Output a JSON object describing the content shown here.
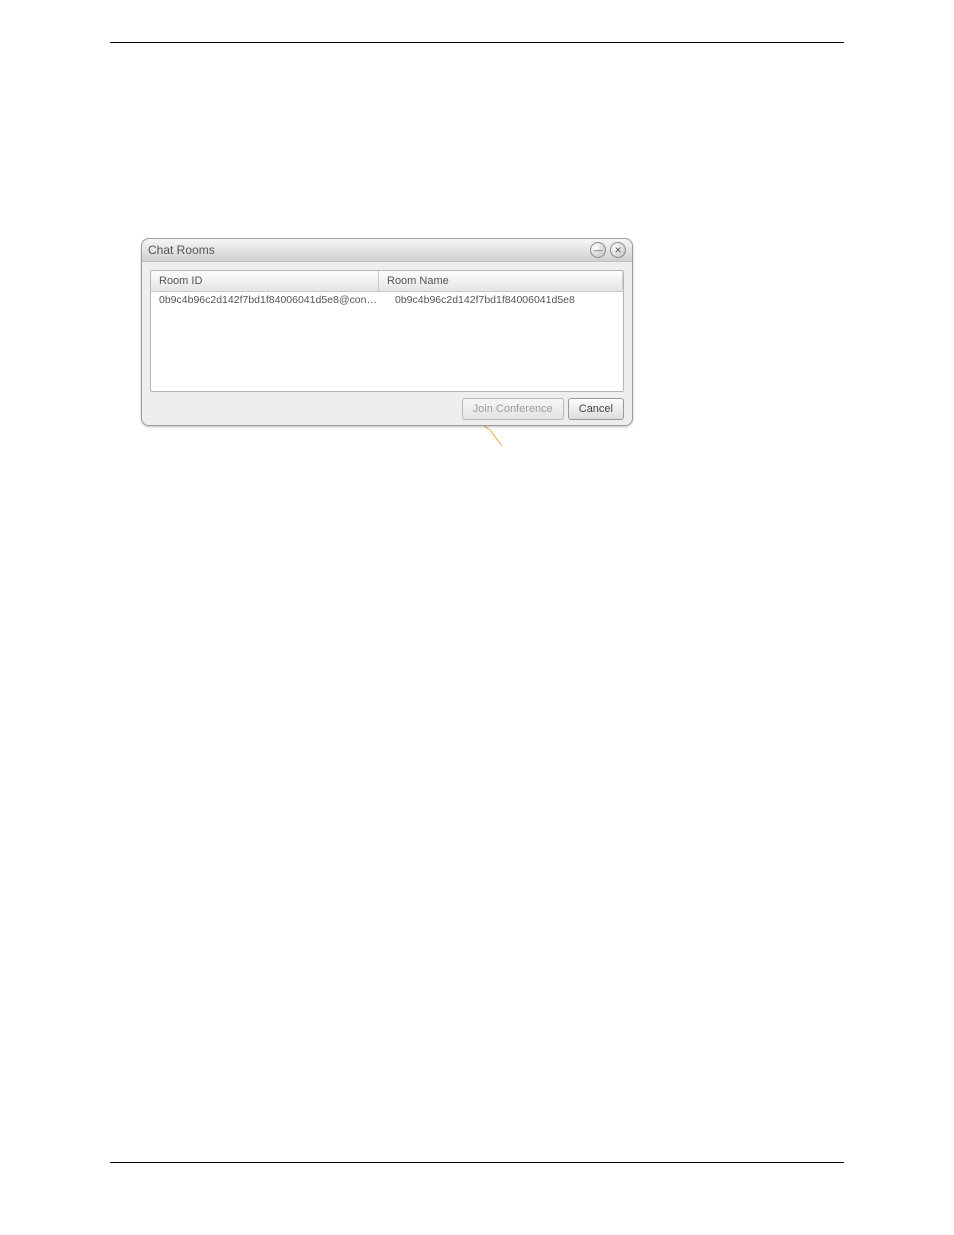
{
  "dialog": {
    "title": "Chat Rooms",
    "columns": {
      "id": "Room ID",
      "name": "Room Name"
    },
    "rows": [
      {
        "id": "0b9c4b96c2d142f7bd1f84006041d5e8@conf…",
        "name": "0b9c4b96c2d142f7bd1f84006041d5e8"
      }
    ],
    "buttons": {
      "join": "Join Conference",
      "cancel": "Cancel"
    },
    "title_icons": {
      "minimize": "—",
      "close": "✕"
    }
  }
}
